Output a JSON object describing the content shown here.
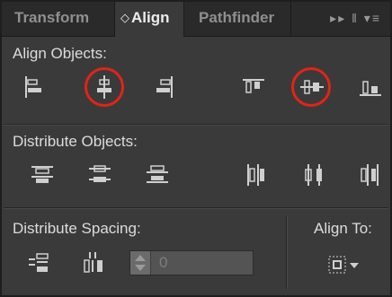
{
  "tabs": [
    {
      "label": "Transform"
    },
    {
      "label": "Align",
      "prefix": "◇"
    },
    {
      "label": "Pathfinder"
    }
  ],
  "tab_tools": "▸▸ ‖ ▾≡",
  "align_objects": {
    "label": "Align Objects:",
    "buttons": [
      {
        "icon": "horizontal-align-left-icon"
      },
      {
        "icon": "horizontal-align-center-icon",
        "highlighted": true
      },
      {
        "icon": "horizontal-align-right-icon"
      },
      {
        "icon": "vertical-align-top-icon"
      },
      {
        "icon": "vertical-align-center-icon",
        "highlighted": true
      },
      {
        "icon": "vertical-align-bottom-icon"
      }
    ]
  },
  "distribute_objects": {
    "label": "Distribute Objects:",
    "buttons": [
      {
        "icon": "vertical-distribute-top-icon"
      },
      {
        "icon": "vertical-distribute-center-icon"
      },
      {
        "icon": "vertical-distribute-bottom-icon"
      },
      {
        "icon": "horizontal-distribute-left-icon"
      },
      {
        "icon": "horizontal-distribute-center-icon"
      },
      {
        "icon": "horizontal-distribute-right-icon"
      }
    ]
  },
  "distribute_spacing": {
    "label": "Distribute Spacing:",
    "buttons": [
      {
        "icon": "vertical-distribute-space-icon"
      },
      {
        "icon": "horizontal-distribute-space-icon"
      }
    ],
    "value": "0"
  },
  "align_to": {
    "label": "Align To:",
    "icon": "align-to-selection-icon"
  },
  "colors": {
    "highlight": "#e2231a",
    "panel": "#3a3a3a",
    "tabbar": "#2a2a2a"
  }
}
